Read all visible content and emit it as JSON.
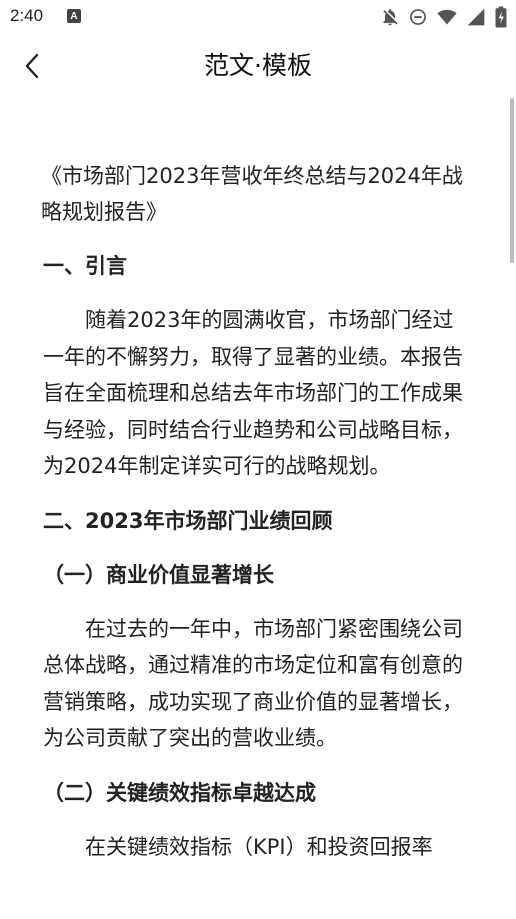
{
  "status_bar": {
    "time": "2:40",
    "a_icon_text": "A",
    "icons": [
      "notifications-off-icon",
      "do-not-disturb-icon",
      "wifi-icon",
      "signal-icon",
      "battery-charging-icon"
    ]
  },
  "app_bar": {
    "back_icon": "chevron-left-icon",
    "title": "范文·模板"
  },
  "document": {
    "title": "《市场部门2023年营收年终总结与2024年战略规划报告》",
    "section1_heading": "一、引言",
    "section1_para": "随着2023年的圆满收官，市场部门经过一年的不懈努力，取得了显著的业绩。本报告旨在全面梳理和总结去年市场部门的工作成果与经验，同时结合行业趋势和公司战略目标，为2024年制定详实可行的战略规划。",
    "section2_heading": "二、2023年市场部门业绩回顾",
    "sub1_heading": "（一）商业价值显著增长",
    "sub1_para": "在过去的一年中，市场部门紧密围绕公司总体战略，通过精准的市场定位和富有创意的营销策略，成功实现了商业价值的显著增长，为公司贡献了突出的营收业绩。",
    "sub2_heading": "（二）关键绩效指标卓越达成",
    "sub2_para": "在关键绩效指标（KPI）和投资回报率"
  }
}
